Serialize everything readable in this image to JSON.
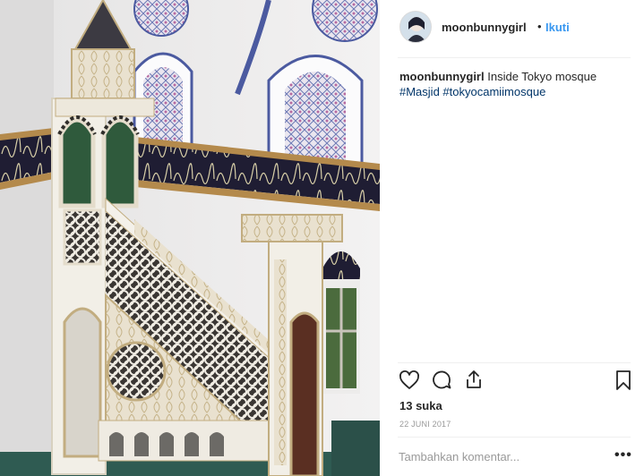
{
  "post": {
    "image_alt": "Inside Tokyo mosque - minbar",
    "username": "moonbunnygirl",
    "separator": "•",
    "follow_label": "Ikuti"
  },
  "caption": {
    "username": "moonbunnygirl",
    "text": "Inside Tokyo mosque",
    "hashtags": [
      "#Masjid",
      "#tokyocamiimosque"
    ]
  },
  "actions": {
    "icons": [
      "heart-icon",
      "comment-icon",
      "share-icon",
      "bookmark-icon"
    ]
  },
  "likes_label": "13 suka",
  "date_label": "22 JUNI 2017",
  "comment_box": {
    "placeholder": "Tambahkan komentar...",
    "value": ""
  },
  "more_label": "•••",
  "colors": {
    "link_blue": "#3897f0",
    "hashtag": "#003569",
    "text": "#262626",
    "muted": "#999999",
    "divider": "#efefef"
  }
}
